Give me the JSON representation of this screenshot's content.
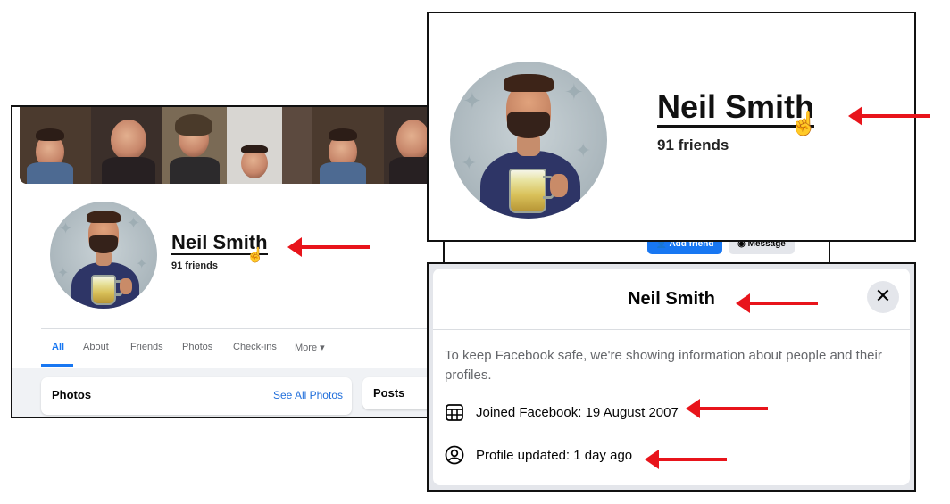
{
  "profile": {
    "name": "Neil Smith",
    "friends": "91 friends"
  },
  "tabs": [
    "All",
    "About",
    "Friends",
    "Photos",
    "Check-ins",
    "More ▾"
  ],
  "cards": {
    "photos_title": "Photos",
    "see_all_photos": "See All Photos",
    "posts_title": "Posts"
  },
  "actions": {
    "add_friend": "Add friend",
    "message": "Message"
  },
  "dialog": {
    "title": "Neil Smith",
    "close": "✕",
    "info_text": "To keep Facebook safe, we're showing information about people and their profiles.",
    "joined": "Joined Facebook: 19 August 2007",
    "updated": "Profile updated: 1 day ago"
  },
  "icons": {
    "cursor": "hand-pointer-icon",
    "calendar": "calendar-icon",
    "profile": "user-circle-icon",
    "close": "close-icon"
  },
  "colors": {
    "arrow": "#e8141b",
    "facebook_blue": "#1877f2",
    "link_blue": "#216fdb"
  }
}
